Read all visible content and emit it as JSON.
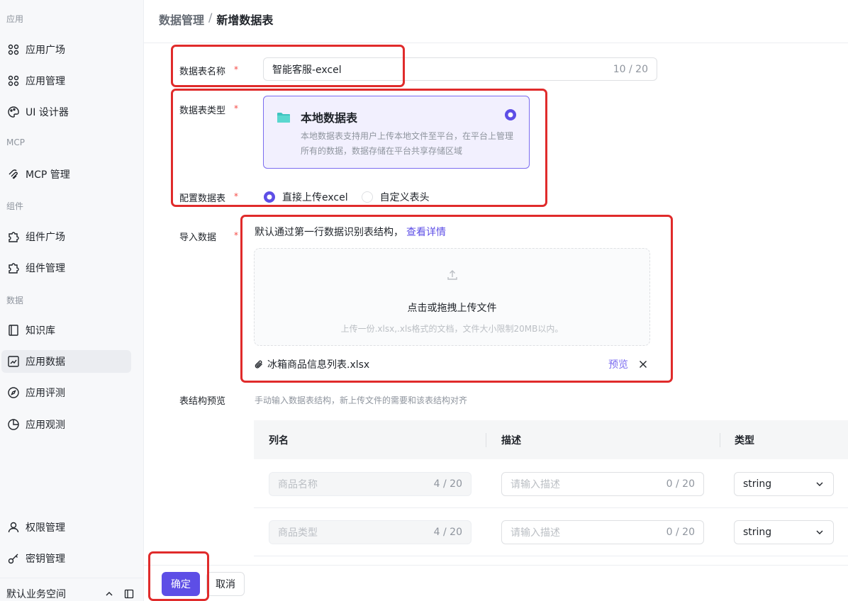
{
  "sidebar": {
    "sections": [
      {
        "label": "应用"
      },
      {
        "label": "MCP"
      },
      {
        "label": "组件"
      },
      {
        "label": "数据"
      }
    ],
    "items": [
      {
        "label": "应用广场",
        "icon": "apps-icon"
      },
      {
        "label": "应用管理",
        "icon": "apps-manage-icon"
      },
      {
        "label": "UI 设计器",
        "icon": "palette-icon"
      },
      {
        "label": "MCP 管理",
        "icon": "mcp-icon"
      },
      {
        "label": "组件广场",
        "icon": "puzzle-icon"
      },
      {
        "label": "组件管理",
        "icon": "puzzle-manage-icon"
      },
      {
        "label": "知识库",
        "icon": "book-icon"
      },
      {
        "label": "应用数据",
        "icon": "chart-icon",
        "active": true
      },
      {
        "label": "应用评测",
        "icon": "compass-icon"
      },
      {
        "label": "应用观测",
        "icon": "pie-icon"
      },
      {
        "label": "权限管理",
        "icon": "user-icon"
      },
      {
        "label": "密钥管理",
        "icon": "key-icon"
      }
    ],
    "workspace": "默认业务空间"
  },
  "breadcrumb": {
    "parent": "数据管理",
    "separator": "/",
    "current": "新增数据表"
  },
  "form": {
    "name_label": "数据表名称",
    "name_value": "智能客服-excel",
    "name_count": "10 / 20",
    "type_label": "数据表类型",
    "type_card_title": "本地数据表",
    "type_card_desc": "本地数据表支持用户上传本地文件至平台，在平台上管理所有的数据，数据存储在平台共享存储区域",
    "config_label": "配置数据表",
    "config_option_1": "直接上传excel",
    "config_option_2": "自定义表头",
    "config_selected": "直接上传excel",
    "import_label": "导入数据",
    "import_hint": "默认通过第一行数据识别表结构，",
    "import_hint_link": "查看详情",
    "upload_title": "点击或拖拽上传文件",
    "upload_sub": "上传一份.xlsx,.xls格式的文档，文件大小限制20MB以内。",
    "file_name": "冰箱商品信息列表.xlsx",
    "file_preview": "预览",
    "schema_label": "表结构预览",
    "schema_hint": "手动输入数据表结构，新上传文件的需要和该表结构对齐",
    "required_mark": "*"
  },
  "table": {
    "headers": [
      "列名",
      "描述",
      "类型"
    ],
    "rows": [
      {
        "name": "商品名称",
        "name_count": "4 / 20",
        "desc_placeholder": "请输入描述",
        "desc_count": "0 / 20",
        "type": "string"
      },
      {
        "name": "商品类型",
        "name_count": "4 / 20",
        "desc_placeholder": "请输入描述",
        "desc_count": "0 / 20",
        "type": "string"
      }
    ]
  },
  "footer": {
    "confirm": "确定",
    "cancel": "取消"
  },
  "colors": {
    "accent": "#5d4ee6",
    "annotation": "#e02b2b",
    "required": "#f54a45"
  }
}
